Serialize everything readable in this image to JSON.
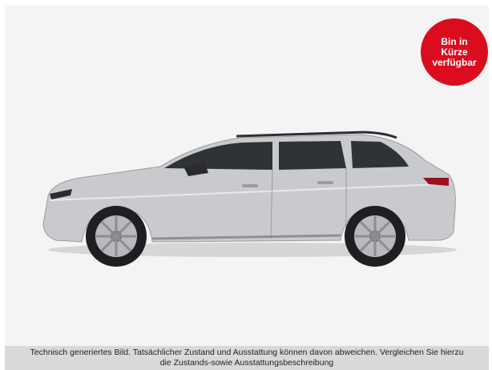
{
  "availability_badge": {
    "text": "Bin in\nKürze\nverfügbar",
    "color": "#dc0c1f"
  },
  "vehicle_image": {
    "subject": "Silver station wagon, side profile",
    "body_color": "#c9cacd"
  },
  "disclaimer": {
    "line1": "Technisch generiertes Bild. Tatsächlicher Zustand und Ausstattung können davon abweichen. Vergleichen Sie hierzu",
    "line2": "die Zustands-sowie Ausstattungsbeschreibung"
  }
}
